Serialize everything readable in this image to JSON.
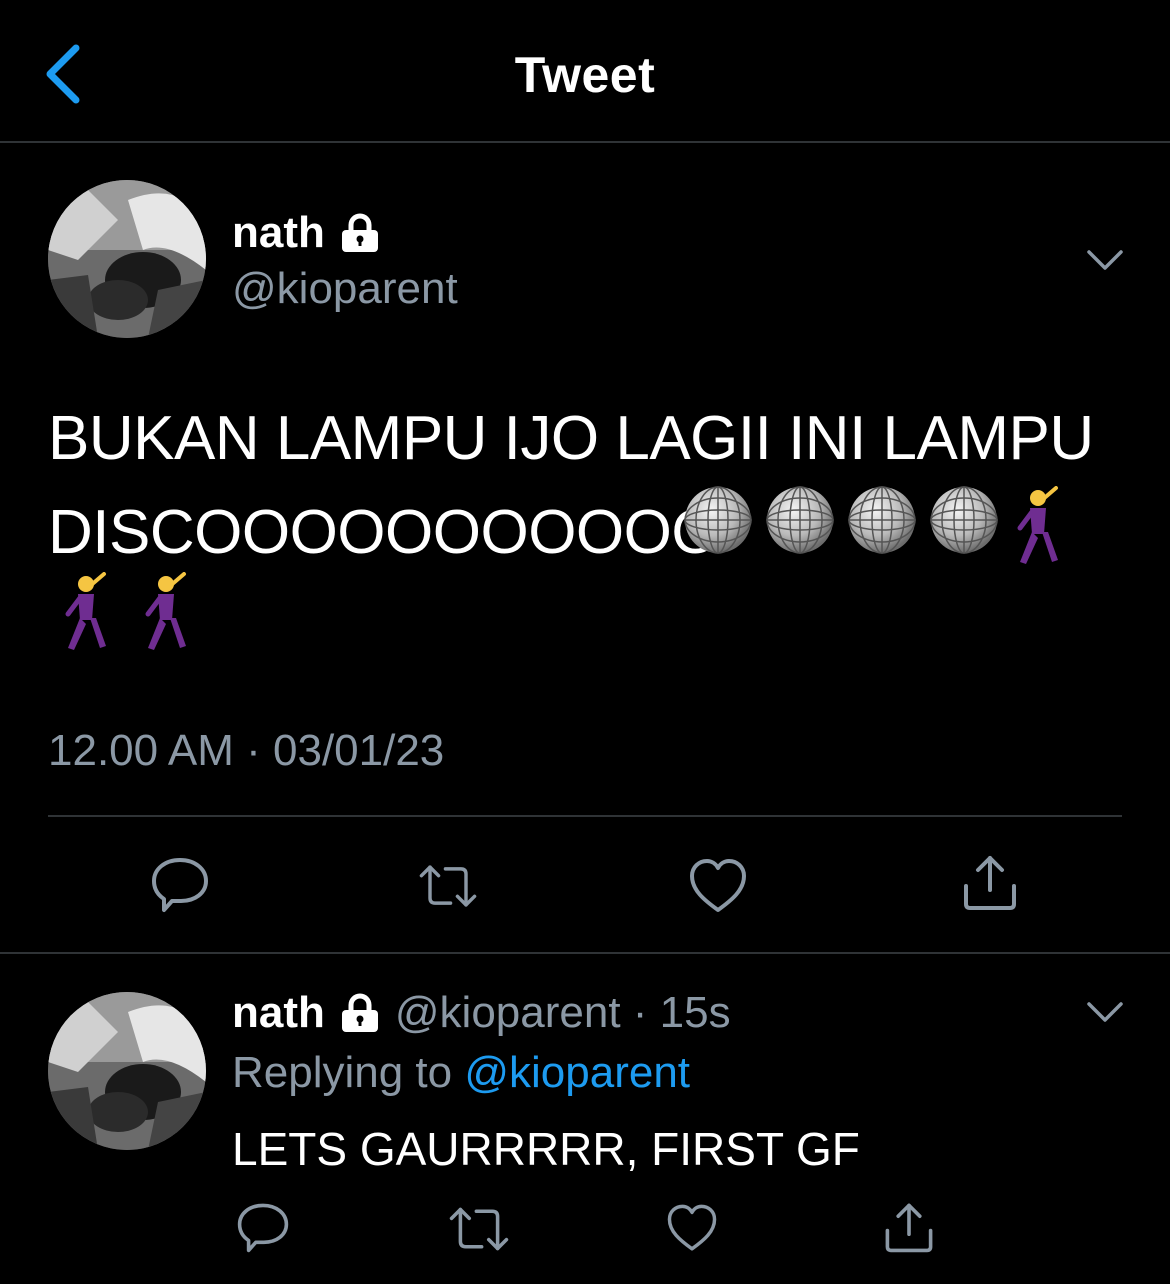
{
  "header": {
    "title": "Tweet"
  },
  "tweet": {
    "author_name": "nath",
    "author_handle": "@kioparent",
    "text_line1": "BUKAN LAMPU IJO LAGII INI LAMPU",
    "text_line2_prefix": "DISCOOOOOOOOOOO",
    "timestamp": "12.00 AM · 03/01/23"
  },
  "reply": {
    "author_name": "nath",
    "author_handle": "@kioparent",
    "separator": " · ",
    "age": "15s",
    "replying_label": "Replying to ",
    "replying_to": "@kioparent",
    "text": "LETS GAURRRRR, FIRST GF"
  },
  "icons": {
    "back": "chevron-left-icon",
    "lock": "lock-icon",
    "caret": "chevron-down-icon",
    "reply": "comment-icon",
    "retweet": "retweet-icon",
    "like": "heart-icon",
    "share": "share-icon",
    "emoji_disco": "mirror-ball-emoji",
    "emoji_dancer": "man-dancing-emoji"
  },
  "colors": {
    "background": "#000000",
    "text": "#ffffff",
    "secondary": "#8b98a5",
    "accent": "#1d9bf0",
    "divider": "#2f3336",
    "dancer_suit": "#6f2d91"
  }
}
